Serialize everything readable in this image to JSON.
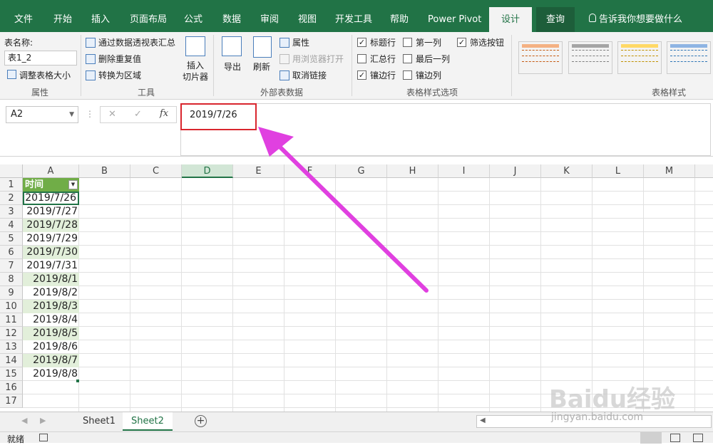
{
  "tabs": [
    "文件",
    "开始",
    "插入",
    "页面布局",
    "公式",
    "数据",
    "审阅",
    "视图",
    "开发工具",
    "帮助",
    "Power Pivot",
    "设计",
    "查询"
  ],
  "tell_me": "告诉我你想要做什么",
  "ribbon": {
    "table_name_label": "表名称:",
    "table_name_value": "表1_2",
    "resize_table": "调整表格大小",
    "group_properties": "属性",
    "pivot_summarize": "通过数据透视表汇总",
    "remove_duplicates": "删除重复值",
    "convert_to_range": "转换为区域",
    "insert_slicer": [
      "插入",
      "切片器"
    ],
    "group_tools": "工具",
    "export": "导出",
    "refresh": "刷新",
    "properties": "属性",
    "open_in_browser": "用浏览器打开",
    "unlink": "取消链接",
    "group_external": "外部表数据",
    "options": {
      "header_row": "标题行",
      "total_row": "汇总行",
      "banded_rows": "镶边行",
      "first_column": "第一列",
      "last_column": "最后一列",
      "banded_columns": "镶边列",
      "filter_button": "筛选按钮"
    },
    "group_style_options": "表格样式选项",
    "group_table_styles": "表格样式"
  },
  "formula_bar": {
    "name_box": "A2",
    "cancel": "✕",
    "enter": "✓",
    "fx": "fx",
    "content": "2019/7/26"
  },
  "columns": [
    "A",
    "B",
    "C",
    "D",
    "E",
    "F",
    "G",
    "H",
    "I",
    "J",
    "K",
    "L",
    "M"
  ],
  "rows": [
    "1",
    "2",
    "3",
    "4",
    "5",
    "6",
    "7",
    "8",
    "9",
    "10",
    "11",
    "12",
    "13",
    "14",
    "15",
    "16",
    "17"
  ],
  "table": {
    "header": "时间",
    "dates": [
      "2019/7/26",
      "2019/7/27",
      "2019/7/28",
      "2019/7/29",
      "2019/7/30",
      "2019/7/31",
      "2019/8/1",
      "2019/8/2",
      "2019/8/3",
      "2019/8/4",
      "2019/8/5",
      "2019/8/6",
      "2019/8/7",
      "2019/8/8"
    ]
  },
  "sheets": [
    "Sheet1",
    "Sheet2"
  ],
  "status": "就绪",
  "watermark": {
    "main": "Baidu经验",
    "sub": "jingyan.baidu.com"
  },
  "colors": {
    "excel_green": "#217346",
    "table_header": "#70ad47",
    "band": "#e2efda",
    "highlight_box": "#d9262e",
    "arrow": "#e040e0"
  }
}
